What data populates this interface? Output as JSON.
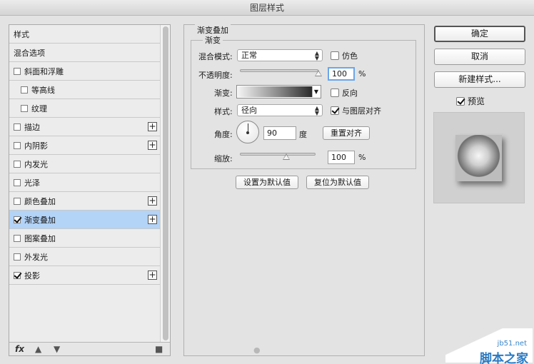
{
  "window": {
    "title": "图层样式"
  },
  "left": {
    "items": [
      {
        "label": "样式",
        "checkbox": false,
        "checked": false,
        "indent": false,
        "plus": false,
        "selected": false
      },
      {
        "label": "混合选项",
        "checkbox": false,
        "checked": false,
        "indent": false,
        "plus": false,
        "selected": false
      },
      {
        "label": "斜面和浮雕",
        "checkbox": true,
        "checked": false,
        "indent": false,
        "plus": false,
        "selected": false
      },
      {
        "label": "等高线",
        "checkbox": true,
        "checked": false,
        "indent": true,
        "plus": false,
        "selected": false
      },
      {
        "label": "纹理",
        "checkbox": true,
        "checked": false,
        "indent": true,
        "plus": false,
        "selected": false
      },
      {
        "label": "描边",
        "checkbox": true,
        "checked": false,
        "indent": false,
        "plus": true,
        "selected": false
      },
      {
        "label": "内阴影",
        "checkbox": true,
        "checked": false,
        "indent": false,
        "plus": true,
        "selected": false
      },
      {
        "label": "内发光",
        "checkbox": true,
        "checked": false,
        "indent": false,
        "plus": false,
        "selected": false
      },
      {
        "label": "光泽",
        "checkbox": true,
        "checked": false,
        "indent": false,
        "plus": false,
        "selected": false
      },
      {
        "label": "颜色叠加",
        "checkbox": true,
        "checked": false,
        "indent": false,
        "plus": true,
        "selected": false
      },
      {
        "label": "渐变叠加",
        "checkbox": true,
        "checked": true,
        "indent": false,
        "plus": true,
        "selected": true
      },
      {
        "label": "图案叠加",
        "checkbox": true,
        "checked": false,
        "indent": false,
        "plus": false,
        "selected": false
      },
      {
        "label": "外发光",
        "checkbox": true,
        "checked": false,
        "indent": false,
        "plus": false,
        "selected": false
      },
      {
        "label": "投影",
        "checkbox": true,
        "checked": true,
        "indent": false,
        "plus": true,
        "selected": false
      }
    ],
    "footer": {
      "fx_label": "fx"
    }
  },
  "gradient_overlay": {
    "section_title": "渐变叠加",
    "group_title": "渐变",
    "blend_mode_label": "混合模式:",
    "blend_mode_value": "正常",
    "dither_label": "仿色",
    "dither_checked": false,
    "opacity_label": "不透明度:",
    "opacity_value": "100",
    "opacity_unit": "%",
    "opacity_level": 1.0,
    "gradient_label": "渐变:",
    "reverse_label": "反向",
    "reverse_checked": false,
    "style_label": "样式:",
    "style_value": "径向",
    "align_label": "与图层对齐",
    "align_checked": true,
    "angle_label": "角度:",
    "angle_value": "90",
    "angle_unit": "度",
    "reset_align_button": "重置对齐",
    "scale_label": "缩放:",
    "scale_value": "100",
    "scale_unit": "%",
    "scale_level": 0.5,
    "set_default_button": "设置为默认值",
    "reset_default_button": "复位为默认值"
  },
  "actions": {
    "ok": "确定",
    "cancel": "取消",
    "new_style": "新建样式...",
    "preview_label": "预览",
    "preview_checked": true
  },
  "watermark": {
    "url": "jb51.net",
    "title": "脚本之家"
  }
}
